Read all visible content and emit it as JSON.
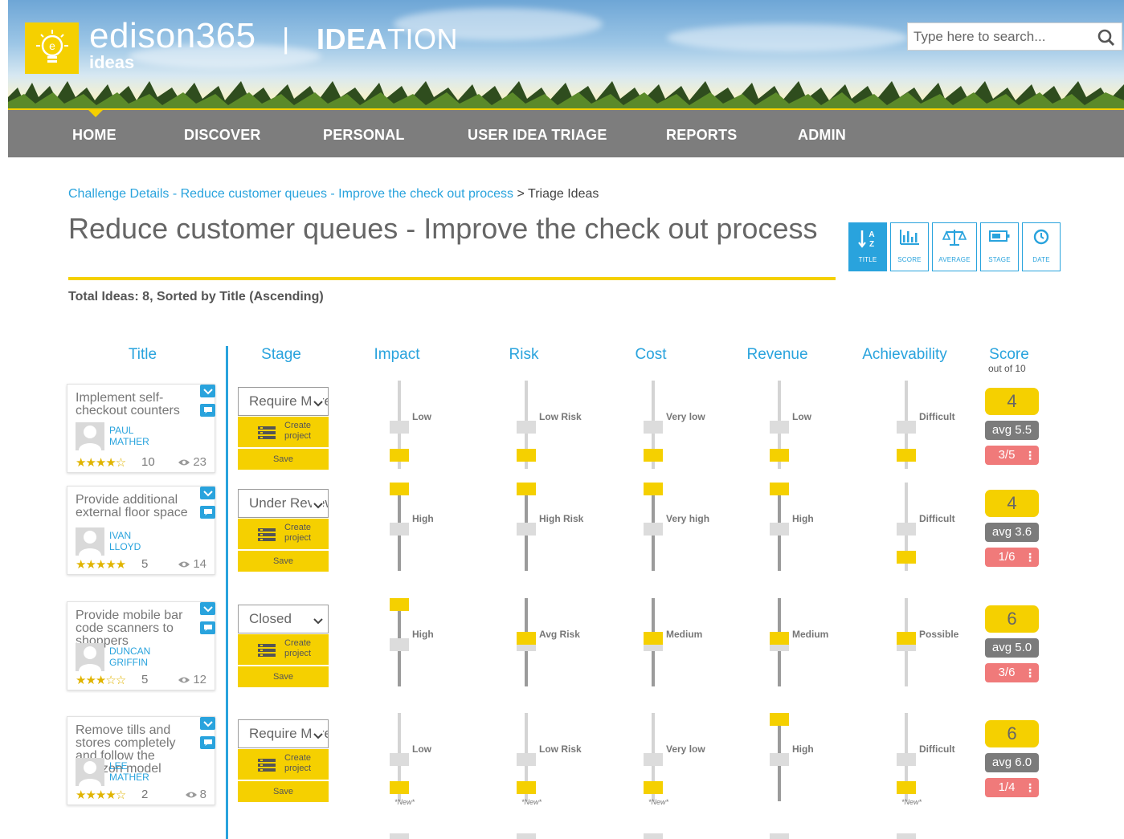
{
  "brand": {
    "name": "edison365",
    "sub": "ideas",
    "separator": "|",
    "product_bold": "IDEA",
    "product_rest": "TION"
  },
  "search": {
    "placeholder": "Type here to search..."
  },
  "nav": [
    "HOME",
    "DISCOVER",
    "PERSONAL",
    "USER IDEA TRIAGE",
    "REPORTS",
    "ADMIN"
  ],
  "breadcrumb": {
    "link": "Challenge Details - Reduce customer queues - Improve the check out process",
    "separator": ">",
    "current": "Triage Ideas"
  },
  "page_title": "Reduce customer queues - Improve the check out process",
  "total_ideas": "Total Ideas: 8, Sorted by Title (Ascending)",
  "sort_buttons": [
    {
      "label": "TITLE",
      "icon": "sort-alpha-icon",
      "active": true
    },
    {
      "label": "SCORE",
      "icon": "bar-chart-icon",
      "active": false
    },
    {
      "label": "AVERAGE",
      "icon": "scales-icon",
      "active": false
    },
    {
      "label": "STAGE",
      "icon": "battery-icon",
      "active": false
    },
    {
      "label": "DATE",
      "icon": "clock-icon",
      "active": false
    }
  ],
  "columns": {
    "title": "Title",
    "stage": "Stage",
    "impact": "Impact",
    "risk": "Risk",
    "cost": "Cost",
    "revenue": "Revenue",
    "achievability": "Achievability",
    "score": "Score",
    "score_sub": "out of 10"
  },
  "buttons": {
    "create_line1": "Create",
    "create_line2": "project",
    "save": "Save"
  },
  "new_tag": "*New*",
  "colors": {
    "accent": "#29a3dd",
    "yellow": "#f5d000",
    "nav": "#7d7d7d",
    "rank": "#f07a7a"
  },
  "ideas": [
    {
      "title": "Implement self-checkout counters",
      "user_first": "PAUL",
      "user_last": "MATHER",
      "stars": "★★★★☆",
      "rating_count": "10",
      "views": "23",
      "stage": "Require More Info",
      "sliders": [
        {
          "label": "Low",
          "level": 0.1
        },
        {
          "label": "Low Risk",
          "level": 0.1
        },
        {
          "label": "Very low",
          "level": 0.1
        },
        {
          "label": "Low",
          "level": 0.1
        },
        {
          "label": "Difficult",
          "level": 0.1
        }
      ],
      "score": "4",
      "avg": "avg 5.5",
      "rank": "3/5"
    },
    {
      "title": "Provide additional external floor space",
      "user_first": "IVAN",
      "user_last": "LLOYD",
      "stars": "★★★★★",
      "rating_count": "5",
      "views": "14",
      "stage": "Under Review",
      "sliders": [
        {
          "label": "High",
          "level": 1.0
        },
        {
          "label": "High Risk",
          "level": 1.0
        },
        {
          "label": "Very high",
          "level": 1.0
        },
        {
          "label": "High",
          "level": 1.0
        },
        {
          "label": "Difficult",
          "level": 0.1
        }
      ],
      "score": "4",
      "avg": "avg 3.6",
      "rank": "1/6"
    },
    {
      "title": "Provide mobile bar code scanners to shoppers",
      "user_first": "DUNCAN",
      "user_last": "GRIFFIN",
      "stars": "★★★☆☆",
      "rating_count": "5",
      "views": "12",
      "stage": "Closed",
      "sliders": [
        {
          "label": "High",
          "level": 1.0
        },
        {
          "label": "Avg Risk",
          "level": 0.55
        },
        {
          "label": "Medium",
          "level": 0.55
        },
        {
          "label": "Medium",
          "level": 0.55
        },
        {
          "label": "Possible",
          "level": 0.55
        }
      ],
      "score": "6",
      "avg": "avg 5.0",
      "rank": "3/6"
    },
    {
      "title": "Remove tills and stores completely and follow the Amazon model",
      "user_first": "LEE",
      "user_last": "MATHER",
      "stars": "★★★★☆",
      "rating_count": "2",
      "views": "8",
      "stage": "Require More Info",
      "sliders": [
        {
          "label": "Low",
          "level": 0.1
        },
        {
          "label": "Low Risk",
          "level": 0.1
        },
        {
          "label": "Very low",
          "level": 0.1
        },
        {
          "label": "High",
          "level": 1.0
        },
        {
          "label": "Difficult",
          "level": 0.1
        }
      ],
      "score": "6",
      "avg": "avg 6.0",
      "rank": "1/4"
    }
  ]
}
